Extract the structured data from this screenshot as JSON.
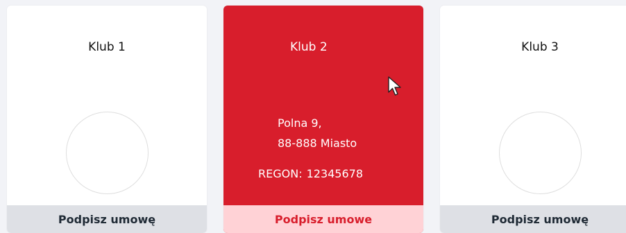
{
  "clubs": [
    {
      "name": "Klub 1",
      "action_label": "Podpisz umowę"
    },
    {
      "name": "Klub 2",
      "address_line1": "Polna 9,",
      "address_line2": "88-888 Miasto",
      "regon_label": "REGON:",
      "regon_value": "12345678",
      "action_label": "Podpisz umowe"
    },
    {
      "name": "Klub 3",
      "action_label": "Podpisz umowę"
    }
  ],
  "colors": {
    "selected_card": "#d81e2c",
    "selected_footer": "#ffd2d6",
    "default_footer": "#dee0e5"
  },
  "icons": {
    "pointer": "mouse-pointer-icon"
  }
}
